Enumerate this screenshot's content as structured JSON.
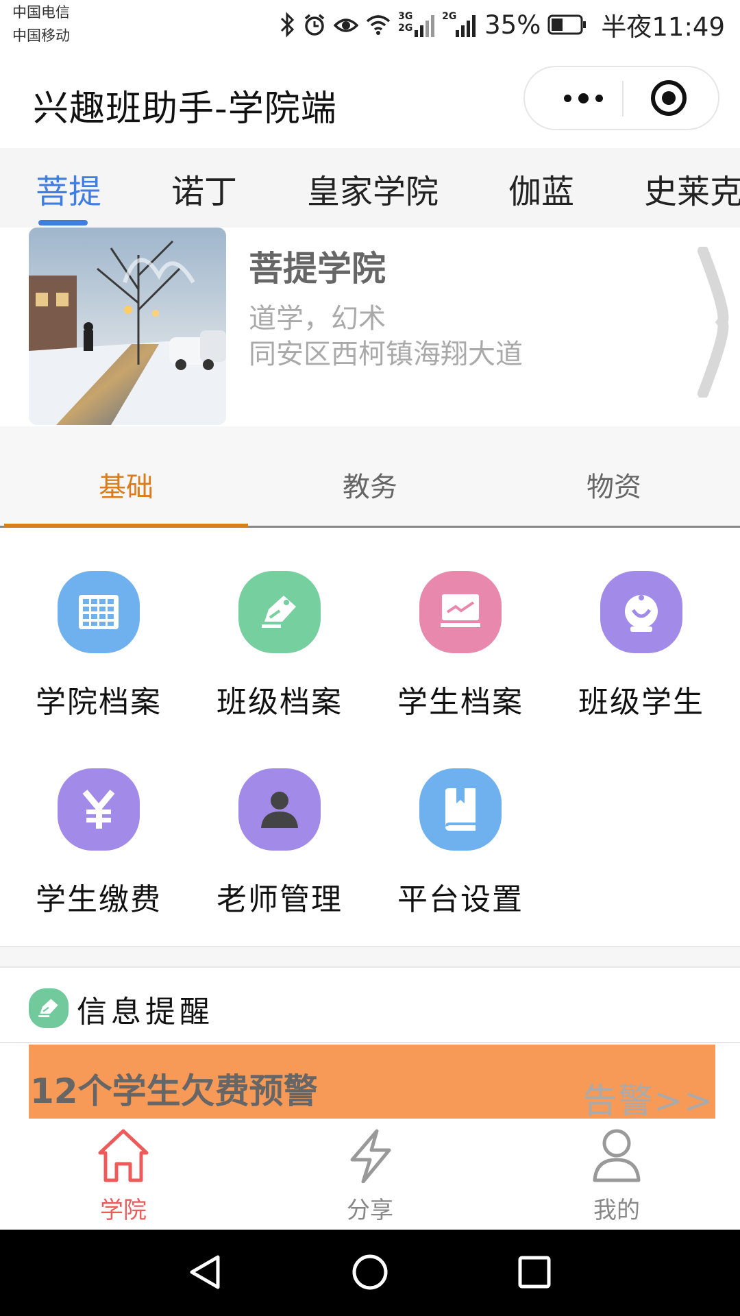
{
  "status_bar": {
    "carrier_1": "中国电信",
    "carrier_2": "中国移动",
    "network_1": "3G 2G",
    "network_2": "2G",
    "battery_percent": "35%",
    "time": "半夜11:49",
    "icons": [
      "bluetooth-icon",
      "alarm-icon",
      "eye-icon",
      "wifi-icon",
      "signal-icon",
      "battery-icon"
    ]
  },
  "header": {
    "title": "兴趣班助手-学院端",
    "icons": [
      "more-dots-icon",
      "close-target-icon"
    ]
  },
  "academy_tabs": {
    "items": [
      "菩提",
      "诺丁",
      "皇家学院",
      "伽蓝",
      "史莱克"
    ],
    "active_index": 0,
    "accent_color": "#3f7de0"
  },
  "academy_card": {
    "name": "菩提学院",
    "subjects": "道学，幻术",
    "address": "同安区西柯镇海翔大道",
    "image": "snowy-street-photo",
    "arrow_icon": "chevron-right-icon"
  },
  "function_tabs": {
    "items": [
      "基础",
      "教务",
      "物资"
    ],
    "active_index": 0,
    "accent_color": "#d97d1c"
  },
  "function_grid": [
    {
      "label": "学院档案",
      "icon": "grid-icon",
      "color": "#6fb1ef"
    },
    {
      "label": "班级档案",
      "icon": "pencil-tag-icon",
      "color": "#76cf9f"
    },
    {
      "label": "学生档案",
      "icon": "chart-board-icon",
      "color": "#e988ad"
    },
    {
      "label": "班级学生",
      "icon": "webcam-icon",
      "color": "#a28be8"
    },
    {
      "label": "学生缴费",
      "icon": "yen-icon",
      "color": "#a28be8"
    },
    {
      "label": "老师管理",
      "icon": "person-icon",
      "color": "#a28be8"
    },
    {
      "label": "平台设置",
      "icon": "book-icon",
      "color": "#6fb1ef"
    }
  ],
  "info_reminder": {
    "title": "信息提醒",
    "icon": "pencil-tag-icon",
    "warning_text": "12个学生欠费预警",
    "warning_link": "告警>>",
    "warning_color": "#f89a57"
  },
  "bottom_nav": {
    "items": [
      {
        "label": "学院",
        "icon": "home-icon"
      },
      {
        "label": "分享",
        "icon": "lightning-icon"
      },
      {
        "label": "我的",
        "icon": "user-icon"
      }
    ],
    "active_index": 0,
    "active_color": "#ec5a5a"
  },
  "system_nav": {
    "icons": [
      "back-triangle-icon",
      "home-circle-icon",
      "recents-square-icon"
    ]
  }
}
